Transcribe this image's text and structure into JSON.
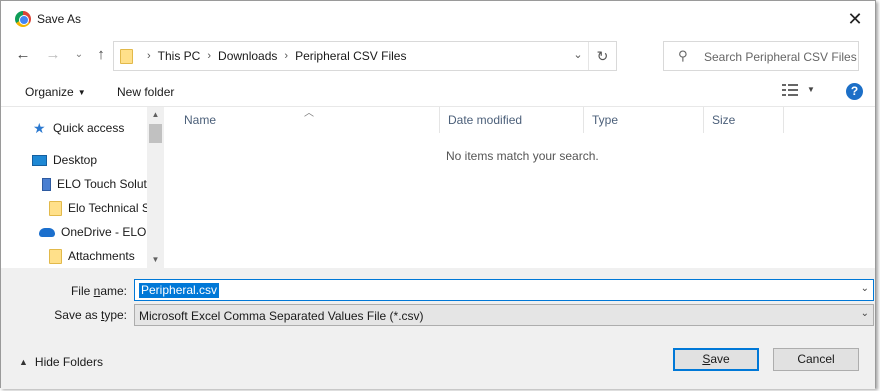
{
  "window": {
    "title": "Save As"
  },
  "nav": {
    "breadcrumb": [
      "This PC",
      "Downloads",
      "Peripheral CSV Files"
    ],
    "search_placeholder": "Search Peripheral CSV Files"
  },
  "toolbar": {
    "organize": "Organize",
    "new_folder": "New folder",
    "help": "?"
  },
  "sidebar": {
    "items": [
      {
        "label": "Quick access",
        "icon": "star-icon"
      },
      {
        "label": "Desktop",
        "icon": "desktop-icon"
      },
      {
        "label": "ELO Touch Solut",
        "icon": "building-icon"
      },
      {
        "label": "Elo Technical S",
        "icon": "folder-icon"
      },
      {
        "label": "OneDrive - ELO T",
        "icon": "cloud-icon"
      },
      {
        "label": "Attachments",
        "icon": "folder-icon"
      }
    ]
  },
  "filelist": {
    "columns": [
      "Name",
      "Date modified",
      "Type",
      "Size"
    ],
    "empty_message": "No items match your search."
  },
  "form": {
    "file_name_label_pre": "File ",
    "file_name_label_key": "n",
    "file_name_label_post": "ame:",
    "file_name_value": "Peripheral.csv",
    "save_type_label_pre": "Save as ",
    "save_type_label_key": "t",
    "save_type_label_post": "ype:",
    "save_type_value": "Microsoft Excel Comma Separated Values File (*.csv)"
  },
  "footer": {
    "hide_folders": "Hide Folders",
    "save_key": "S",
    "save_rest": "ave",
    "cancel": "Cancel"
  },
  "colors": {
    "accent": "#0078d7",
    "help_icon": "#1c6fc7",
    "folder": "#ffe08a"
  }
}
